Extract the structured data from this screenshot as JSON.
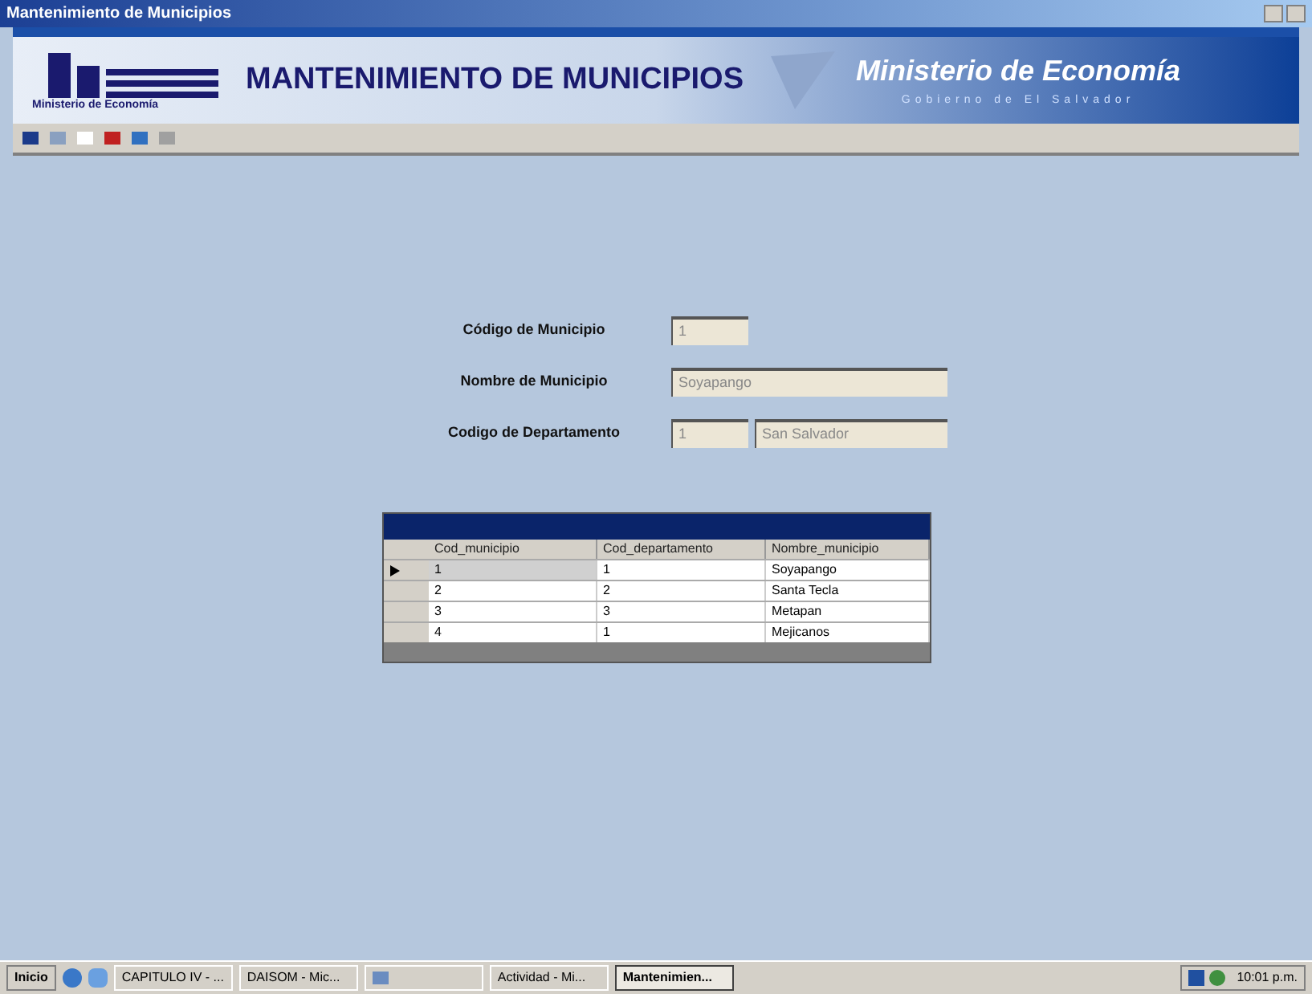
{
  "window": {
    "title": "Mantenimiento de Municipios"
  },
  "header": {
    "title": "MANTENIMIENTO DE MUNICIPIOS",
    "logo_caption": "Ministerio de Economía",
    "brand": "Ministerio de Economía",
    "brand_subtitle": "Gobierno de El Salvador"
  },
  "form": {
    "fields": [
      {
        "label": "Código de Municipio",
        "value": "1"
      },
      {
        "label": "Nombre de Municipio",
        "value": "Soyapango"
      },
      {
        "label": "Codigo de Departamento",
        "value": "1",
        "value_2": "San Salvador"
      }
    ]
  },
  "table": {
    "columns": [
      "Cod_municipio",
      "Cod_departamento",
      "Nombre_municipio"
    ],
    "rows": [
      {
        "cells": [
          "1",
          "1",
          "Soyapango"
        ],
        "selected": true
      },
      {
        "cells": [
          "2",
          "2",
          "Santa Tecla"
        ],
        "selected": false
      },
      {
        "cells": [
          "3",
          "3",
          "Metapan"
        ],
        "selected": false
      },
      {
        "cells": [
          "4",
          "1",
          "Mejicanos"
        ],
        "selected": false
      }
    ]
  },
  "taskbar": {
    "start": "Inicio",
    "tasks": [
      {
        "label": "CAPITULO IV - ...",
        "selected": false
      },
      {
        "label": "DAISOM - Mic...",
        "selected": false
      },
      {
        "selected": false
      },
      {
        "label": "Actividad - Mi...",
        "selected": false
      },
      {
        "label": "Mantenimien...",
        "selected": true
      }
    ],
    "clock": "10:01 p.m."
  }
}
